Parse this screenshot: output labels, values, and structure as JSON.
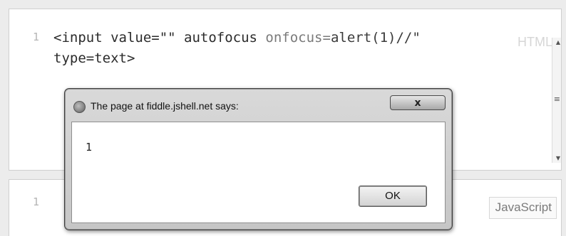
{
  "html_editor": {
    "line_number": "1",
    "code_line1_tag": "<input value=\"\" ",
    "code_line1_attr1": "autofocus",
    "code_line1_attr2": " onfocus=",
    "code_line1_value": "alert(1)//\"",
    "code_line2": "type=text>",
    "language_label": "HTML"
  },
  "js_editor": {
    "line_number": "1",
    "language_label": "JavaScript"
  },
  "alert_dialog": {
    "title": "The page at fiddle.jshell.net says:",
    "close_glyph": "x",
    "message": "1",
    "ok_label": "OK"
  },
  "scrollbar": {
    "up_arrow": "▲",
    "down_arrow": "▼",
    "grip": "≡"
  }
}
